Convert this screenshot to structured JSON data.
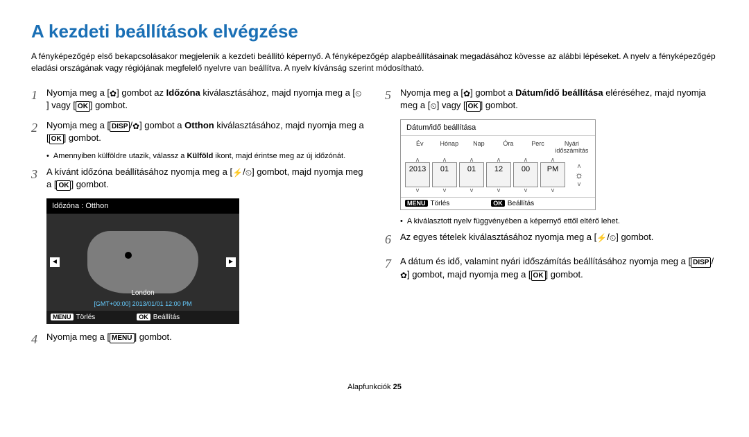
{
  "title": "A kezdeti beállítások elvégzése",
  "intro": "A fényképezőgép első bekapcsolásakor megjelenik a kezdeti beállító képernyő. A fényképezőgép alapbeállításainak megadásához kövesse az alábbi lépéseket. A nyelv a fényképezőgép eladási országának vagy régiójának megfelelő nyelvre van beállítva. A nyelv kívánság szerint módosítható.",
  "steps": {
    "s1a": "Nyomja meg a [",
    "s1b": "] gombot az ",
    "s1bold": "Időzóna",
    "s1c": " kiválasztásához, majd nyomja meg a [",
    "s1d": "] vagy [",
    "s1e": "] gombot.",
    "s2a": "Nyomja meg a [",
    "s2b": "] gombot a ",
    "s2bold": "Otthon",
    "s2c": " kiválasztásához, majd nyomja meg a [",
    "s2d": "] gombot.",
    "s2bullet_a": "Amennyiben külföldre utazik, válassz a ",
    "s2bullet_bold": "Külföld",
    "s2bullet_b": " ikont, majd érintse meg az új időzónát.",
    "s3a": "A kívánt időzóna beállításához nyomja meg a [",
    "s3b": "] gombot, majd nyomja meg a [",
    "s3c": "] gombot.",
    "s4a": "Nyomja meg a [",
    "s4b": "] gombot.",
    "s5a": "Nyomja meg a [",
    "s5b": "] gombot a ",
    "s5bold": "Dátum/idő beállítása",
    "s5c": " eléréséhez, majd nyomja meg a [",
    "s5d": "] vagy [",
    "s5e": "] gombot.",
    "s6a": "Az egyes tételek kiválasztásához nyomja meg a [",
    "s6b": "] gombot.",
    "s7a": "A dátum és idő, valamint nyári időszámítás beállításához nyomja meg a [",
    "s7b": "] gombot, majd nyomja meg a [",
    "s7c": "] gombot.",
    "dt_bullet": "A kiválasztott nyelv függvényében a képernyő ettől eltérő lehet."
  },
  "tz_panel": {
    "title": "Időzóna : Otthon",
    "city": "London",
    "gmt": "[GMT+00:00] 2013/01/01 12:00 PM",
    "cancel_btn": "MENU",
    "cancel_txt": "Törlés",
    "set_btn": "OK",
    "set_txt": "Beállítás"
  },
  "dt_panel": {
    "title": "Dátum/idő beállítása",
    "cols": {
      "year": "Év",
      "month": "Hónap",
      "day": "Nap",
      "hour": "Óra",
      "min": "Perc",
      "dst": "Nyári időszámítás"
    },
    "vals": {
      "year": "2013",
      "month": "01",
      "day": "01",
      "hour": "12",
      "min": "00",
      "ampm": "PM"
    },
    "cancel_btn": "MENU",
    "cancel_txt": "Törlés",
    "set_btn": "OK",
    "set_txt": "Beállítás"
  },
  "footer": {
    "section": "Alapfunkciók",
    "page": "25"
  },
  "btn": {
    "ok": "OK",
    "disp": "DISP",
    "menu": "MENU"
  },
  "dst_icon": "☀✖"
}
